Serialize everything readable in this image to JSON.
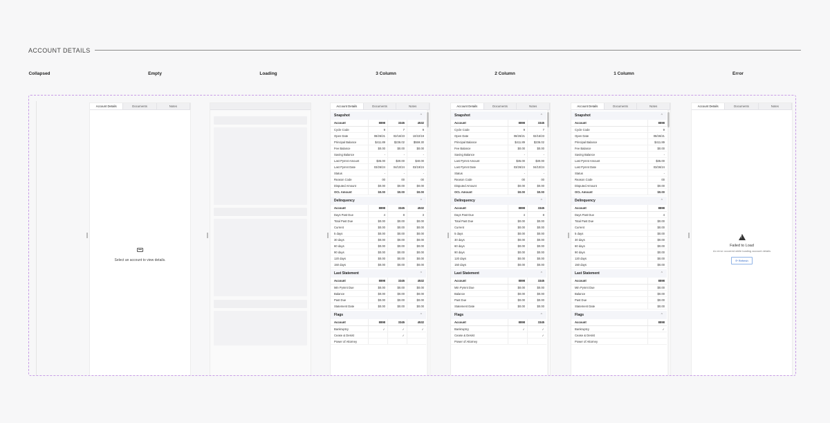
{
  "section_title": "ACCOUNT DETAILS",
  "variants": [
    "Collapsed",
    "Empty",
    "Loading",
    "3 Column",
    "2 Column",
    "1 Column",
    "Error"
  ],
  "tabs": [
    "Account Details",
    "Documents",
    "Notes"
  ],
  "empty_message": "Select an account to view details.",
  "error": {
    "title": "Failed to Load",
    "message": "An error occurred while loading account details",
    "button": "Refresh"
  },
  "accounts": [
    "8898",
    "3345",
    "4532"
  ],
  "sections": [
    {
      "title": "Snapshot",
      "rows": [
        {
          "label": "Cycle Code",
          "values": [
            "9",
            "7",
            "9"
          ]
        },
        {
          "label": "Open Date",
          "values": [
            "08/26/21",
            "02/16/23",
            "10/22/19"
          ]
        },
        {
          "label": "Principal Balance",
          "values": [
            "$411.89",
            "$236.02",
            "$559.30"
          ]
        },
        {
          "label": "Fee Balance",
          "values": [
            "$0.00",
            "$0.00",
            "$0.00"
          ]
        },
        {
          "label": "Saving Balance",
          "values": [
            "-",
            "-",
            "-"
          ]
        },
        {
          "label": "Last Pymnt Amount",
          "values": [
            "$35.00",
            "$30.00",
            "$40.00"
          ]
        },
        {
          "label": "Last Pymnt Date",
          "values": [
            "03/26/24",
            "04/10/24",
            "03/19/24"
          ]
        },
        {
          "label": "Status",
          "values": [
            "-",
            "-",
            "-"
          ]
        },
        {
          "label": "Reason Code",
          "values": [
            "00",
            "00",
            "00"
          ]
        },
        {
          "label": "Disputed Amount",
          "values": [
            "$0.00",
            "$0.00",
            "$0.00"
          ]
        },
        {
          "label": "OCL Amount",
          "values": [
            "$0.00",
            "$0.00",
            "$0.00"
          ],
          "bold": true
        }
      ]
    },
    {
      "title": "Delinquency",
      "rows": [
        {
          "label": "Days Past Due",
          "values": [
            "4",
            "8",
            "3"
          ]
        },
        {
          "label": "Total Past Due",
          "values": [
            "$0.00",
            "$0.00",
            "$0.00"
          ]
        },
        {
          "label": "Current",
          "values": [
            "$0.00",
            "$0.00",
            "$0.00"
          ]
        },
        {
          "label": "5 days",
          "values": [
            "$0.00",
            "$0.00",
            "$0.00"
          ]
        },
        {
          "label": "30 days",
          "values": [
            "$0.00",
            "$0.00",
            "$0.00"
          ]
        },
        {
          "label": "60 days",
          "values": [
            "$0.00",
            "$0.00",
            "$0.00"
          ]
        },
        {
          "label": "90 days",
          "values": [
            "$0.00",
            "$0.00",
            "$0.00"
          ]
        },
        {
          "label": "120 days",
          "values": [
            "$0.00",
            "$0.00",
            "$0.00"
          ]
        },
        {
          "label": "150 days",
          "values": [
            "$0.00",
            "$0.00",
            "$0.00"
          ]
        }
      ]
    },
    {
      "title": "Last Statement",
      "rows": [
        {
          "label": "Min Pymnt Due",
          "values": [
            "$0.00",
            "$0.00",
            "$0.00"
          ]
        },
        {
          "label": "Balance",
          "values": [
            "$0.00",
            "$0.00",
            "$0.00"
          ]
        },
        {
          "label": "Past Due",
          "values": [
            "$0.00",
            "$0.00",
            "$0.00"
          ]
        },
        {
          "label": "Statement Date",
          "values": [
            "$0.00",
            "$0.00",
            "$0.00"
          ]
        }
      ]
    },
    {
      "title": "Flags",
      "rows": [
        {
          "label": "Bankruptcy",
          "values": [
            "✓",
            "✓",
            "✓"
          ]
        },
        {
          "label": "Cease & Desist",
          "values": [
            "",
            "✓",
            ""
          ]
        },
        {
          "label": "Power of Attorney",
          "values": [
            "",
            "",
            ""
          ]
        }
      ]
    }
  ]
}
